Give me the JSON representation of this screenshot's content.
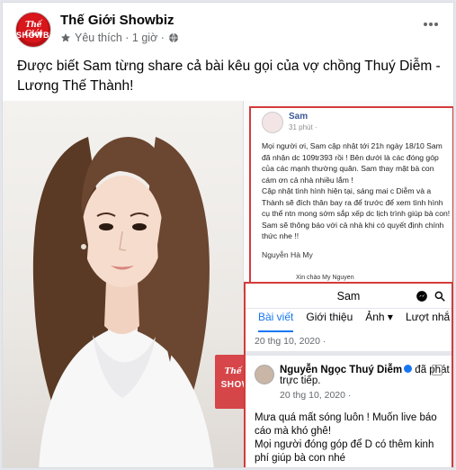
{
  "post": {
    "page_name": "Thế Giới Showbiz",
    "meta_text": "Yêu thích · 1 giờ ·",
    "caption": "Được biết Sam từng share cả bài kêu gọi của vợ chồng Thuý Diễm - Lương Thế Thành!",
    "logo_top": "Thế Giới",
    "logo_bottom": "SHOWBIZ"
  },
  "image": {
    "watermark_top": "Thế Giới",
    "watermark_bottom": "SHOWBIZ",
    "sam_post": {
      "name": "Sam",
      "time": "31 phút ·",
      "body": "Mọi người ơi, Sam cập nhật tới 21h ngày 18/10 Sam đã nhận dc 109tr393 rồi ! Bên dưới là các đóng góp của các mạnh thường quân. Sam thay mặt bà con cám ơn cả nhà nhiều lắm !\nCập nhật tình hình hiện tại, sáng mai c Diễm và a Thành sẽ đích thân bay ra để trước để xem tình hình cụ thể ntn mong sớm sắp xếp dc lịch trình giúp bà con! Sam sẽ thông báo với cả nhà khi có quyết định chính thức nhe !!",
      "signature": "Nguyễn Hà My",
      "sub": "Xin chào My Nguyen"
    },
    "fb_profile": {
      "title": "Sam",
      "tabs": [
        "Bài viết",
        "Giới thiệu",
        "Ảnh ▾",
        "Lượt nhắ"
      ],
      "row1_date": "20 thg 10, 2020 · ",
      "author": "Nguyễn Ngọc Thuý Diễm",
      "action": " đã phát trực tiếp.",
      "date2": "20 thg 10, 2020 · ",
      "text": "Mưa quá mất sóng luôn ! Muốn live báo cáo mà khó ghê!\nMọi người đóng góp để D có thêm kinh phí giúp bà con nhé"
    }
  },
  "colors": {
    "fb_blue": "#1877f2",
    "brand_red": "#d8161b",
    "highlight_border": "#d43b3b"
  }
}
